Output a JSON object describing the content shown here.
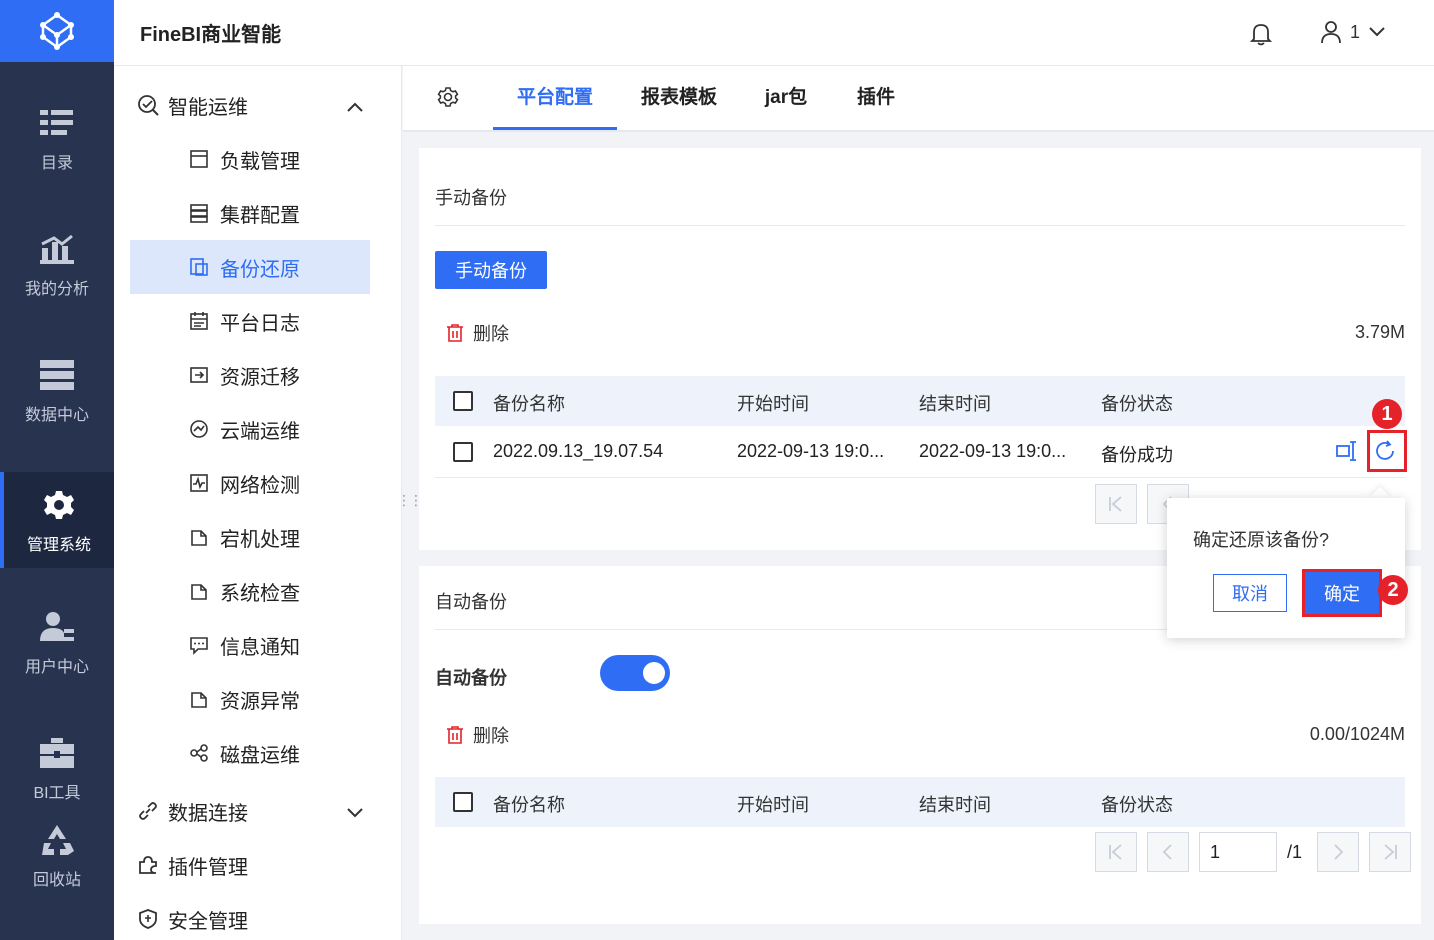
{
  "app": {
    "title": "FineBI商业智能"
  },
  "header": {
    "user_label": "1"
  },
  "nav": {
    "items": [
      {
        "label": "目录",
        "icon": "catalog-icon"
      },
      {
        "label": "我的分析",
        "icon": "analysis-icon"
      },
      {
        "label": "数据中心",
        "icon": "data-center-icon"
      },
      {
        "label": "管理系统",
        "icon": "gear-icon",
        "active": true
      },
      {
        "label": "用户中心",
        "icon": "user-icon"
      },
      {
        "label": "BI工具",
        "icon": "toolbox-icon"
      },
      {
        "label": "回收站",
        "icon": "recycle-icon"
      }
    ]
  },
  "menu": {
    "group_ops": "智能运维",
    "items": [
      {
        "label": "负载管理"
      },
      {
        "label": "集群配置"
      },
      {
        "label": "备份还原",
        "active": true
      },
      {
        "label": "平台日志"
      },
      {
        "label": "资源迁移"
      },
      {
        "label": "云端运维"
      },
      {
        "label": "网络检测"
      },
      {
        "label": "宕机处理"
      },
      {
        "label": "系统检查"
      },
      {
        "label": "信息通知"
      },
      {
        "label": "资源异常"
      },
      {
        "label": "磁盘运维"
      }
    ],
    "group_data": "数据连接",
    "group_plugin": "插件管理",
    "group_security": "安全管理"
  },
  "tabs": [
    "平台配置",
    "报表模板",
    "jar包",
    "插件"
  ],
  "manual": {
    "title": "手动备份",
    "button": "手动备份",
    "delete": "删除",
    "size": "3.79M",
    "columns": [
      "备份名称",
      "开始时间",
      "结束时间",
      "备份状态"
    ],
    "row": {
      "name": "2022.09.13_19.07.54",
      "start": "2022-09-13 19:0...",
      "end": "2022-09-13 19:0...",
      "status": "备份成功"
    }
  },
  "auto": {
    "title": "自动备份",
    "toggle_label": "自动备份",
    "toggle_on": true,
    "delete": "删除",
    "size": "0.00/1024M",
    "columns": [
      "备份名称",
      "开始时间",
      "结束时间",
      "备份状态"
    ],
    "page_input": "1",
    "page_total": "/1"
  },
  "popover": {
    "question": "确定还原该备份?",
    "cancel": "取消",
    "confirm": "确定"
  },
  "badges": {
    "step1": "1",
    "step2": "2"
  },
  "colors": {
    "accent": "#2f6ef4",
    "nav_bg": "#27334f",
    "highlight": "#e5212a"
  }
}
